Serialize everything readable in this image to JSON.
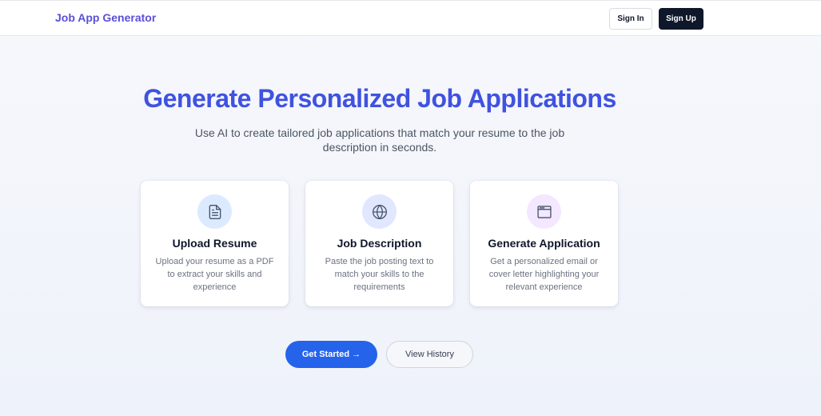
{
  "header": {
    "brand": "Job App Generator",
    "sign_in": "Sign In",
    "sign_up": "Sign Up"
  },
  "hero": {
    "title": "Generate Personalized Job Applications",
    "subtitle": "Use AI to create tailored job applications that match your resume to the job description in seconds."
  },
  "features": [
    {
      "icon": "document-icon",
      "title": "Upload Resume",
      "description": "Upload your resume as a PDF to extract your skills and experience",
      "icon_bg": "#dbeafe",
      "icon_color": "#475569"
    },
    {
      "icon": "globe-icon",
      "title": "Job Description",
      "description": "Paste the job posting text to match your skills to the requirements",
      "icon_bg": "#e0e7ff",
      "icon_color": "#475569"
    },
    {
      "icon": "browser-window-icon",
      "title": "Generate Application",
      "description": "Get a personalized email or cover letter highlighting your relevant experience",
      "icon_bg": "#f3e8ff",
      "icon_color": "#475569"
    }
  ],
  "actions": {
    "get_started": "Get Started →",
    "view_history": "View History"
  },
  "colors": {
    "brand": "#5b4fd8",
    "title": "#3f52e0",
    "primary": "#2563eb",
    "dark_button": "#0f172a"
  }
}
